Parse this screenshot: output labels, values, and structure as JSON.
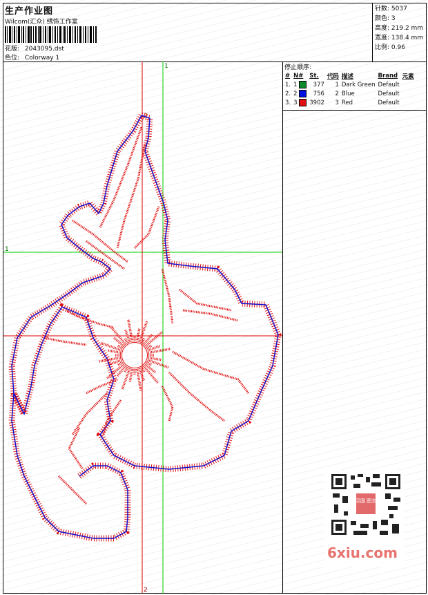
{
  "header": {
    "title": "生产作业图",
    "studio": "Wilcom(汇众) 绣饰工作室",
    "design_label": "花版:",
    "design_file": "2043095.dst",
    "colorway_label": "色位:",
    "colorway": "Colorway 1"
  },
  "stats": [
    {
      "label": "针数:",
      "value": "5037"
    },
    {
      "label": "颜色:",
      "value": "3"
    },
    {
      "label": "高度:",
      "value": "219.2 mm"
    },
    {
      "label": "宽度:",
      "value": "138.4 mm"
    },
    {
      "label": "比例:",
      "value": "0.96"
    }
  ],
  "stop_sequence": {
    "caption": "停止顺序:",
    "headers": [
      "#",
      "N#",
      "St.",
      "代码",
      "描述",
      "Brand",
      "元素"
    ],
    "rows": [
      {
        "idx": "1.",
        "n": "1",
        "color": "#0a8a2a",
        "stitches": "377",
        "code": "1",
        "desc": "Dark Green",
        "brand": "Default"
      },
      {
        "idx": "2.",
        "n": "2",
        "color": "#0010e0",
        "stitches": "756",
        "code": "2",
        "desc": "Blue",
        "brand": "Default"
      },
      {
        "idx": "3.",
        "n": "3",
        "color": "#e01010",
        "stitches": "3902",
        "code": "3",
        "desc": "Red",
        "brand": "Default"
      }
    ]
  },
  "guides": {
    "green_v": "1",
    "green_h": "1",
    "red_v": "2"
  },
  "watermark": {
    "text": "6xiu.com",
    "qr_label": "汉国 图文"
  },
  "colors": {
    "stitch_red": "#e01010",
    "stitch_blue": "#1010d0",
    "guide_green": "#00cc00",
    "guide_red": "#dd0000"
  }
}
